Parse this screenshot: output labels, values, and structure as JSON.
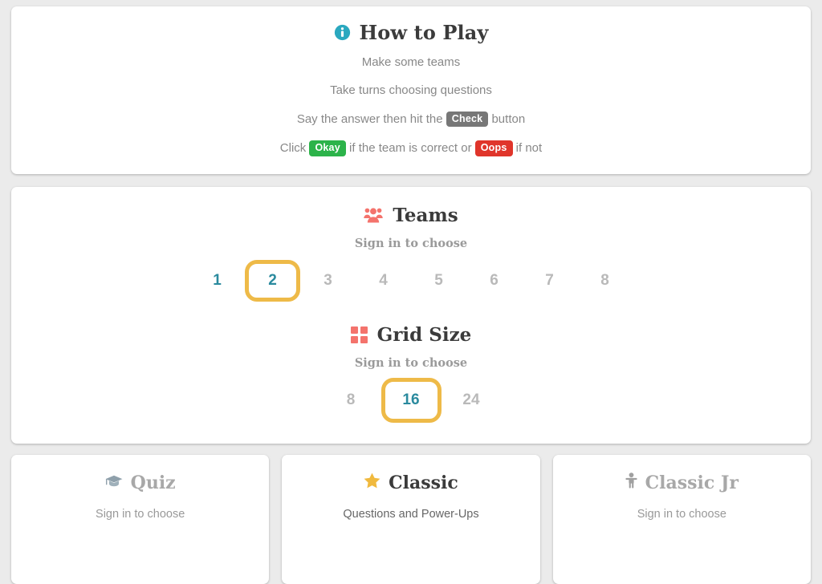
{
  "how_to_play": {
    "title": "How to Play",
    "icon": "info-circle-icon",
    "icon_color": "#2aa8bf",
    "lines": [
      {
        "parts": [
          {
            "type": "text",
            "text": "Make some teams"
          }
        ]
      },
      {
        "parts": [
          {
            "type": "text",
            "text": "Take turns choosing questions"
          }
        ]
      },
      {
        "parts": [
          {
            "type": "text",
            "text": "Say the answer then hit the "
          },
          {
            "type": "badge",
            "text": "Check",
            "style": "check",
            "color": "#777777"
          },
          {
            "type": "text",
            "text": " button"
          }
        ]
      },
      {
        "parts": [
          {
            "type": "text",
            "text": "Click "
          },
          {
            "type": "badge",
            "text": "Okay",
            "style": "okay",
            "color": "#2cb34a"
          },
          {
            "type": "text",
            "text": " if the team is correct or "
          },
          {
            "type": "badge",
            "text": "Oops",
            "style": "oops",
            "color": "#e0352b"
          },
          {
            "type": "text",
            "text": " if not"
          }
        ]
      }
    ],
    "line_0": "Make some teams",
    "line_1": "Take turns choosing questions",
    "line_2_a": "Say the answer then hit the ",
    "line_2_badge": "Check",
    "line_2_b": " button",
    "line_3_a": "Click ",
    "line_3_badge_ok": "Okay",
    "line_3_b": " if the team is correct or ",
    "line_3_badge_bad": "Oops",
    "line_3_c": " if not"
  },
  "teams": {
    "title": "Teams",
    "icon": "users-group-icon",
    "icon_color": "#f4736c",
    "note": "Sign in to choose",
    "options": [
      {
        "label": "1",
        "enabled": true,
        "selected": false
      },
      {
        "label": "2",
        "enabled": true,
        "selected": true
      },
      {
        "label": "3",
        "enabled": false,
        "selected": false
      },
      {
        "label": "4",
        "enabled": false,
        "selected": false
      },
      {
        "label": "5",
        "enabled": false,
        "selected": false
      },
      {
        "label": "6",
        "enabled": false,
        "selected": false
      },
      {
        "label": "7",
        "enabled": false,
        "selected": false
      },
      {
        "label": "8",
        "enabled": false,
        "selected": false
      }
    ],
    "selected_value": "2"
  },
  "grid_size": {
    "title": "Grid Size",
    "icon": "grid-2x2-icon",
    "icon_color": "#f4736c",
    "note": "Sign in to choose",
    "options": [
      {
        "label": "8",
        "enabled": false,
        "selected": false
      },
      {
        "label": "16",
        "enabled": true,
        "selected": true
      },
      {
        "label": "24",
        "enabled": false,
        "selected": false
      }
    ],
    "selected_value": "16"
  },
  "modes": [
    {
      "title": "Quiz",
      "subtitle": "Sign in to choose",
      "icon": "graduation-cap-icon",
      "icon_color": "#8fa0ab",
      "active": false
    },
    {
      "title": "Classic",
      "subtitle": "Questions and Power-Ups",
      "icon": "star-icon",
      "icon_color": "#f0b93e",
      "active": true
    },
    {
      "title": "Classic Jr",
      "subtitle": "Sign in to choose",
      "icon": "child-icon",
      "icon_color": "#a0a0a0",
      "active": false
    }
  ],
  "colors": {
    "background": "#ebebeb",
    "card": "#ffffff",
    "accent_teal": "#2a8a9e",
    "accent_gold": "#eeba48",
    "muted": "#b9b9b9",
    "heading": "#3b3b3b"
  }
}
